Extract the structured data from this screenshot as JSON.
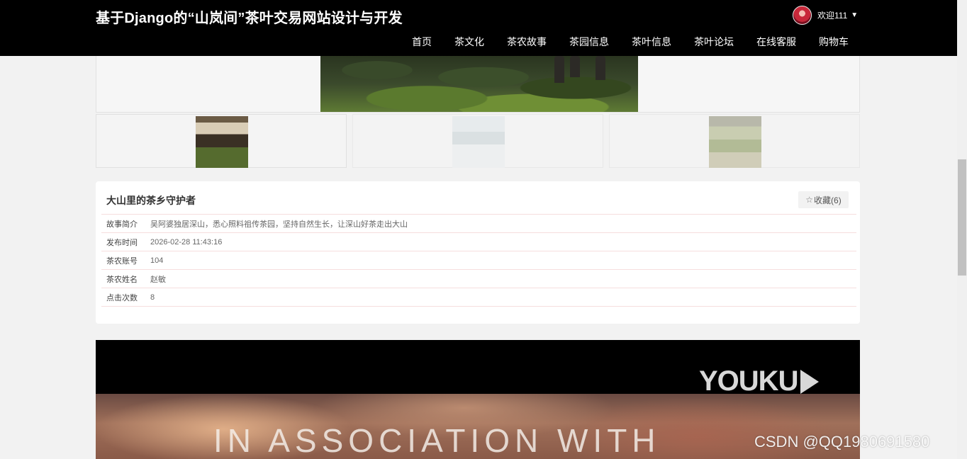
{
  "header": {
    "site_title": "基于Django的“山岚间”茶叶交易网站设计与开发",
    "user_greeting": "欢迎111",
    "nav": [
      "首页",
      "茶文化",
      "茶农故事",
      "茶园信息",
      "茶叶信息",
      "茶叶论坛",
      "在线客服",
      "购物车"
    ]
  },
  "story": {
    "title": "大山里的茶乡守护者",
    "favorite_label": "收藏(6)",
    "fields": [
      {
        "label": "故事简介",
        "value": "吴阿婆独居深山，悉心照料祖传茶园，坚持自然生长，让深山好茶走出大山"
      },
      {
        "label": "发布时间",
        "value": "2026-02-28 11:43:16"
      },
      {
        "label": "茶农账号",
        "value": "104"
      },
      {
        "label": "茶农姓名",
        "value": "赵敏"
      },
      {
        "label": "点击次数",
        "value": "8"
      }
    ]
  },
  "video": {
    "brand": "YOUKU",
    "caption": "IN ASSOCIATION WITH"
  },
  "watermark": "CSDN @QQ1980691580",
  "colors": {
    "header_bg": "#000000",
    "page_bg": "#f2f2f2",
    "row_border": "#f6dede"
  }
}
